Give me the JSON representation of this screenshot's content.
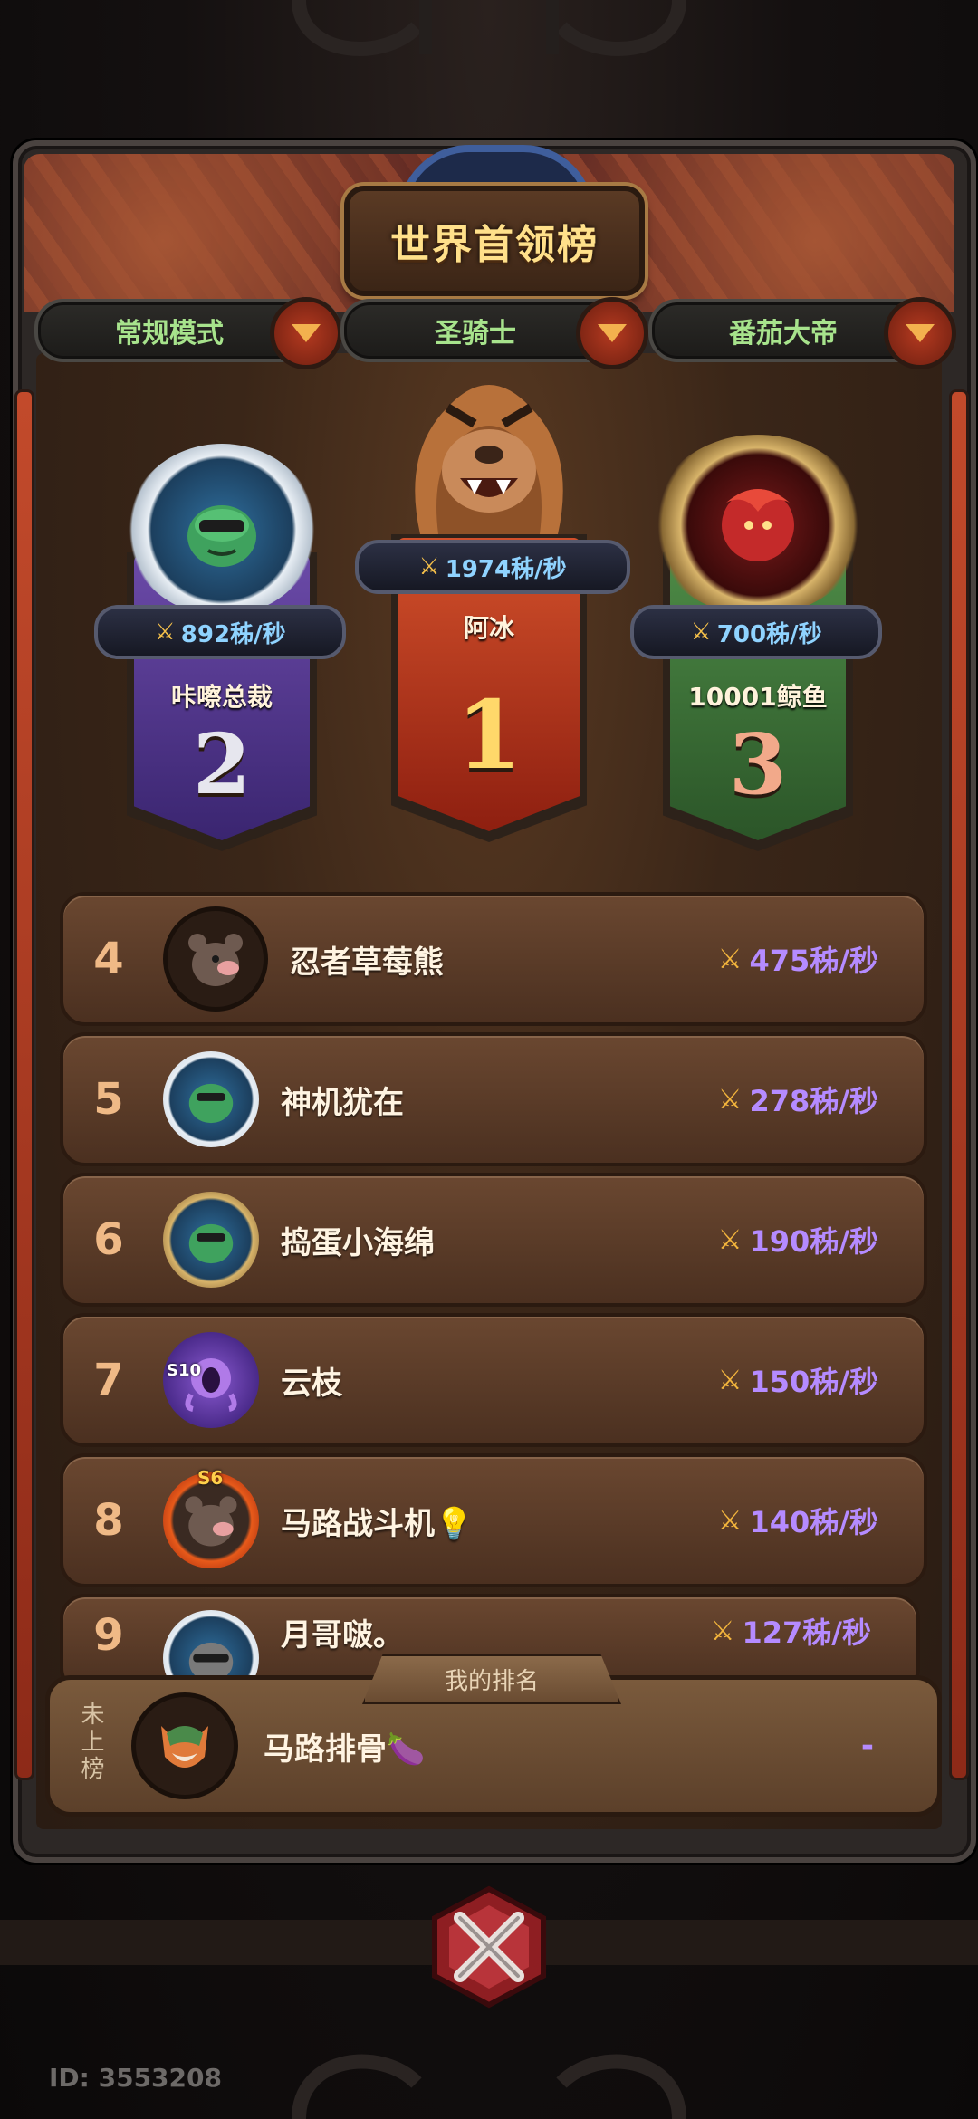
{
  "title": "世界首领榜",
  "filters": [
    {
      "label": "常规模式"
    },
    {
      "label": "圣骑士"
    },
    {
      "label": "番茄大帝"
    }
  ],
  "podium": {
    "first": {
      "rank": "1",
      "name": "阿冰",
      "score": "1974秭/秒"
    },
    "second": {
      "rank": "2",
      "name": "咔嚓总裁",
      "score": "892秭/秒"
    },
    "third": {
      "rank": "3",
      "name": "10001鲸鱼",
      "score": "700秭/秒"
    }
  },
  "rows": [
    {
      "rank": "4",
      "name": "忍者草莓熊",
      "score": "475秭/秒"
    },
    {
      "rank": "5",
      "name": "神机犹在",
      "score": "278秭/秒"
    },
    {
      "rank": "6",
      "name": "捣蛋小海绵",
      "score": "190秭/秒"
    },
    {
      "rank": "7",
      "name": "云枝",
      "score": "150秭/秒",
      "badge": "S10"
    },
    {
      "rank": "8",
      "name": "马路战斗机💡",
      "score": "140秭/秒",
      "badge": "S6"
    },
    {
      "rank": "9",
      "name": "月哥啵。",
      "score": "127秭/秒"
    }
  ],
  "my_rank": {
    "tag": "我的排名",
    "status": "未上榜",
    "name": "马路排骨🍆",
    "score": "-"
  },
  "user_id": "ID: 3553208",
  "icons": {
    "score": "crossed-swords-icon",
    "dropdown": "triangle-down-icon",
    "close": "crossed-close-icon"
  },
  "colors": {
    "title_gold": "#ffe08a",
    "filter_green": "#a7e38c",
    "score_purple": "#b58bff",
    "score_blue": "#8fd3ff",
    "gold_rank": "#ffd86a",
    "silver_rank": "#e6e6ee",
    "bronze_rank": "#f2a98a"
  }
}
